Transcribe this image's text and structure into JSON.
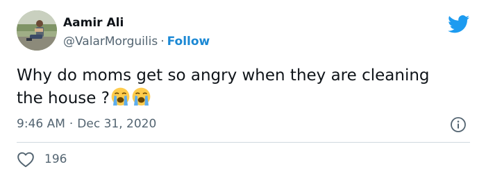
{
  "user": {
    "name": "Aamir Ali",
    "handle": "@ValarMorguilis",
    "separator": "·",
    "follow_label": "Follow"
  },
  "tweet": {
    "text": "Why do moms get so angry when they are cleaning the house ?",
    "emojis": [
      "loudly-crying-face-icon",
      "loudly-crying-face-icon"
    ],
    "time": "9:46 AM",
    "separator": "·",
    "date": "Dec 31, 2020",
    "likes": "196"
  },
  "colors": {
    "accent": "#1b88d4",
    "text": "#0f1419",
    "muted": "#536471",
    "divider": "#cfd9de",
    "twitter_blue": "#1d9bf0"
  },
  "icons": {
    "logo": "twitter-bird-icon",
    "info": "info-icon",
    "like": "heart-icon"
  }
}
